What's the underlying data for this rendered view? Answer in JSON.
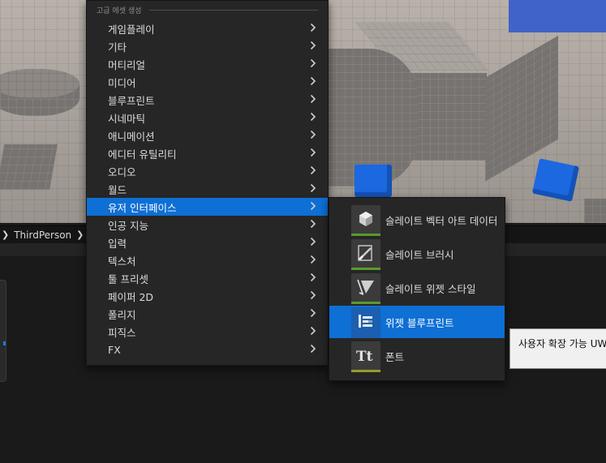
{
  "breadcrumb": {
    "item": "ThirdPerson"
  },
  "context_menu": {
    "header": "고급 에셋 생성",
    "items": [
      {
        "label": "게임플레이"
      },
      {
        "label": "기타"
      },
      {
        "label": "머티리얼"
      },
      {
        "label": "미디어"
      },
      {
        "label": "블루프린트"
      },
      {
        "label": "시네마틱"
      },
      {
        "label": "애니메이션"
      },
      {
        "label": "에디터 유틸리티"
      },
      {
        "label": "오디오"
      },
      {
        "label": "월드"
      },
      {
        "label": "유저 인터페이스",
        "selected": true
      },
      {
        "label": "인공 지능"
      },
      {
        "label": "입력"
      },
      {
        "label": "텍스처"
      },
      {
        "label": "툴 프리셋"
      },
      {
        "label": "페이퍼 2D"
      },
      {
        "label": "폴리지"
      },
      {
        "label": "피직스"
      },
      {
        "label": "FX"
      }
    ]
  },
  "submenu": {
    "items": [
      {
        "label": "슬레이트 벡터 아트 데이터",
        "icon": "vector-art-icon",
        "bar_color": "#5a9a2e"
      },
      {
        "label": "슬레이트 브러시",
        "icon": "brush-icon",
        "bar_color": "#5a9a2e"
      },
      {
        "label": "슬레이트 위젯 스타일",
        "icon": "widget-style-icon",
        "bar_color": "#5a9a2e"
      },
      {
        "label": "위젯 블루프린트",
        "icon": "widget-blueprint-icon",
        "bar_color": "#1c5fb0",
        "selected": true
      },
      {
        "label": "폰트",
        "icon": "font-icon",
        "bar_color": "#9a9a2e"
      }
    ]
  },
  "tooltip": {
    "text": "사용자 확장 가능 UWidget"
  },
  "colors": {
    "accent": "#0e6fd5",
    "menu_bg": "#262626"
  }
}
